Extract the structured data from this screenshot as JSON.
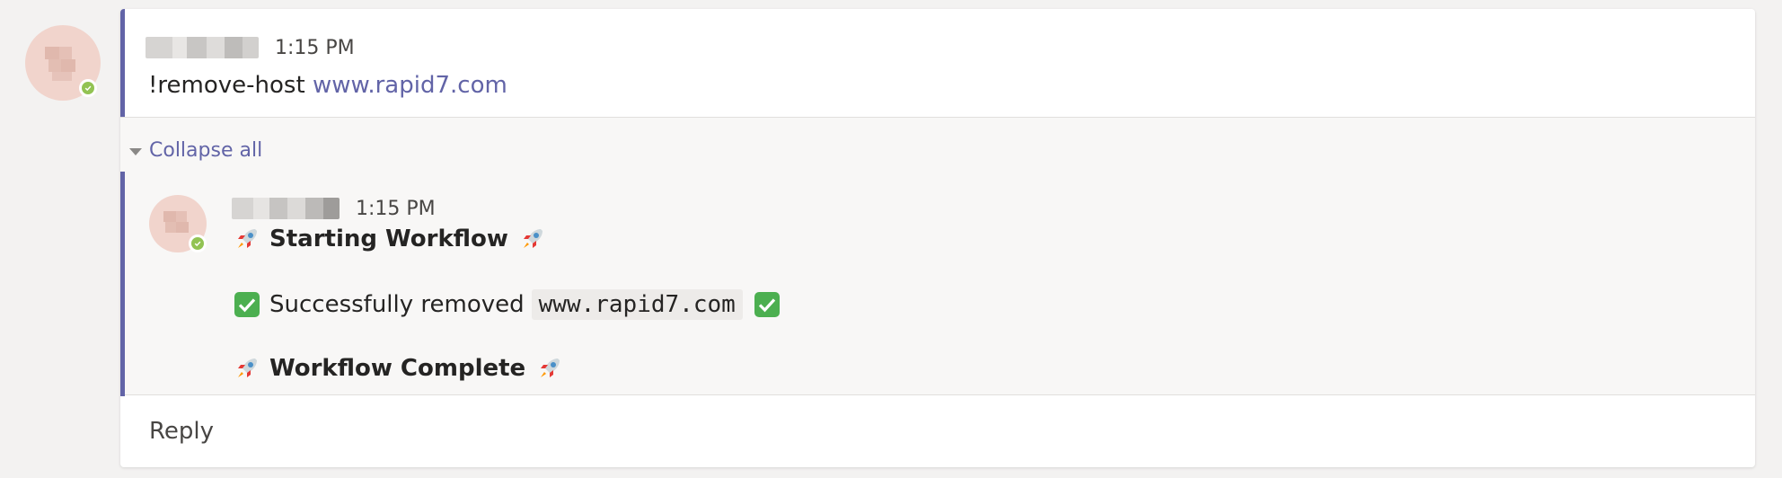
{
  "message": {
    "timestamp": "1:15 PM",
    "command": "!remove-host",
    "link": "www.rapid7.com"
  },
  "thread": {
    "collapse_label": "Collapse all",
    "reply": {
      "timestamp": "1:15 PM",
      "line1": "Starting Workflow",
      "line2_prefix": "Successfully removed",
      "line2_code": "www.rapid7.com",
      "line3": "Workflow Complete"
    }
  },
  "composer": {
    "reply_label": "Reply"
  },
  "colors": {
    "accent": "#6264a7",
    "presence": "#92c353",
    "avatar_bg": "#f1d4cc"
  },
  "icons": [
    "rocket-icon",
    "check-mark-icon",
    "presence-available-icon",
    "caret-down-icon"
  ]
}
